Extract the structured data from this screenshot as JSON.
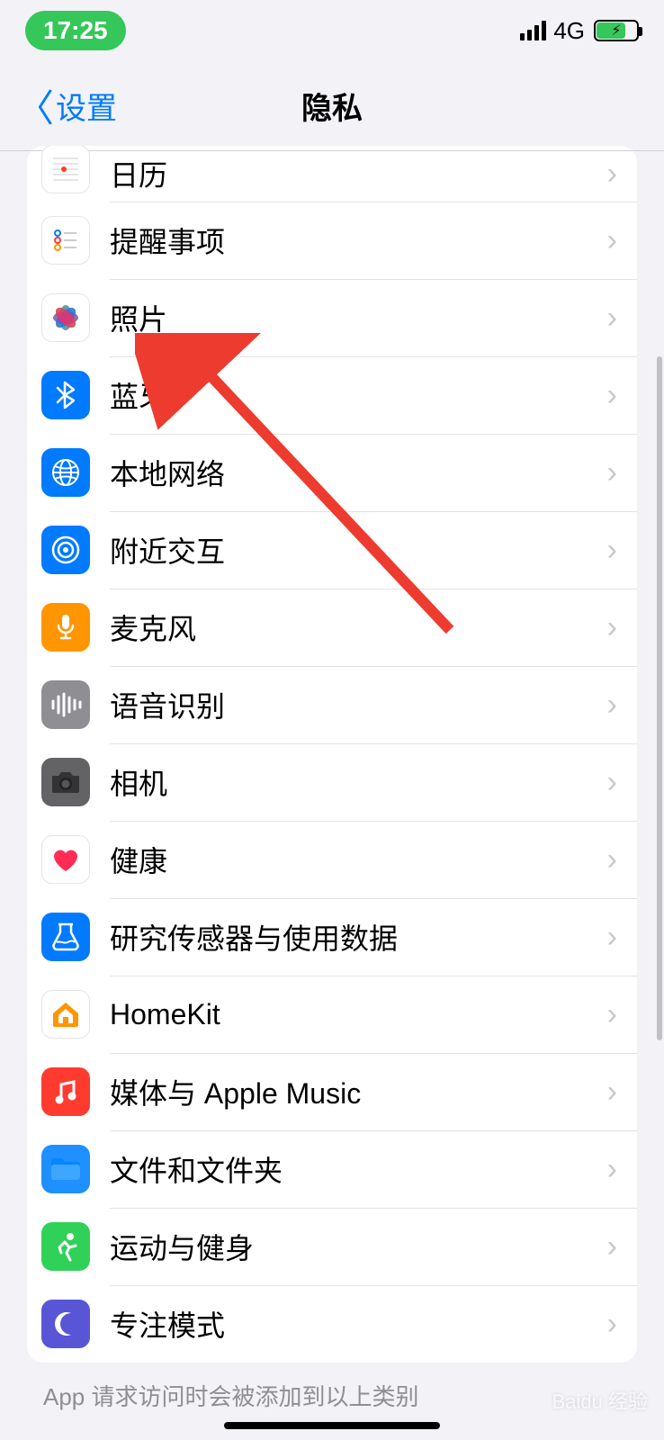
{
  "status": {
    "time": "17:25",
    "network": "4G"
  },
  "nav": {
    "back_label": "设置",
    "title": "隐私"
  },
  "rows": [
    {
      "id": "calendar",
      "label": "日历"
    },
    {
      "id": "reminders",
      "label": "提醒事项"
    },
    {
      "id": "photos",
      "label": "照片"
    },
    {
      "id": "bluetooth",
      "label": "蓝牙"
    },
    {
      "id": "localnetwork",
      "label": "本地网络"
    },
    {
      "id": "nearby",
      "label": "附近交互"
    },
    {
      "id": "mic",
      "label": "麦克风"
    },
    {
      "id": "speech",
      "label": "语音识别"
    },
    {
      "id": "camera",
      "label": "相机"
    },
    {
      "id": "health",
      "label": "健康"
    },
    {
      "id": "research",
      "label": "研究传感器与使用数据"
    },
    {
      "id": "homekit",
      "label": "HomeKit"
    },
    {
      "id": "media",
      "label": "媒体与 Apple Music"
    },
    {
      "id": "files",
      "label": "文件和文件夹"
    },
    {
      "id": "fitness",
      "label": "运动与健身"
    },
    {
      "id": "focus",
      "label": "专注模式"
    }
  ],
  "footer_note": "App 请求访问时会被添加到以上类别",
  "watermark": "Baidu 经验"
}
